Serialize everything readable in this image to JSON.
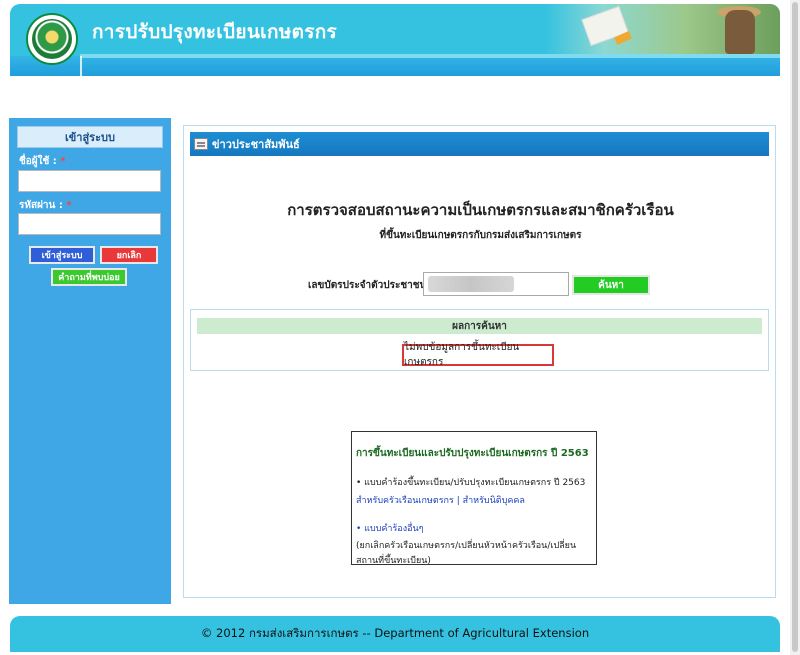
{
  "header": {
    "title": "การปรับปรุงทะเบียนเกษตรกร",
    "logo_icon": "doae-logo-icon"
  },
  "sidebar": {
    "login_title": "เข้าสู่ระบบ",
    "username_label": "ชื่อผู้ใช้ :",
    "username_value": "",
    "password_label": "รหัสผ่าน :",
    "password_value": "",
    "required_mark": "*",
    "login_button": "เข้าสู่ระบบ",
    "cancel_button": "ยกเลิก",
    "faq_button": "คำถามที่พบบ่อย"
  },
  "main": {
    "news_bar_title": "ข่าวประชาสัมพันธ์",
    "heading": "การตรวจสอบสถานะความเป็นเกษตรกรและสมาชิกครัวเรือน",
    "subheading": "ที่ขึ้นทะเบียนเกษตรกรกับกรมส่งเสริมการเกษตร",
    "id_label": "เลขบัตรประจำตัวประชาชน:",
    "id_value": "",
    "search_button": "ค้นหา",
    "result_header": "ผลการค้นหา",
    "result_message": "ไม่พบข้อมูลการขึ้นทะเบียนเกษตรกร"
  },
  "info": {
    "title": "การขึ้นทะเบียนและปรับปรุงทะเบียนเกษตรกร ปี 2563",
    "item1": "• แบบคำร้องขึ้นทะเบียน/ปรับปรุงทะเบียนเกษตรกร ปี 2563",
    "link_household": "สำหรับครัวเรือนเกษตรกร",
    "link_sep": " | ",
    "link_juristic": "สำหรับนิติบุคคล",
    "link_other": "• แบบคำร้องอื่นๆ",
    "other_desc": "(ยกเลิกครัวเรือนเกษตรกร/เปลี่ยนหัวหน้าครัวเรือน/เปลี่ยนสถานที่ขึ้นทะเบียน)"
  },
  "footer": {
    "text": "© 2012 กรมส่งเสริมการเกษตร -- Department of Agricultural Extension"
  },
  "colors": {
    "header_bg": "#34c2e0",
    "sidebar_bg": "#3fa7e6",
    "news_bar_bg": "#1e8ed3",
    "login_btn": "#2f5fd8",
    "cancel_btn": "#e8383a",
    "green_btn": "#22cc22",
    "result_header_bg": "#cdeccf",
    "result_border": "#d93838"
  }
}
